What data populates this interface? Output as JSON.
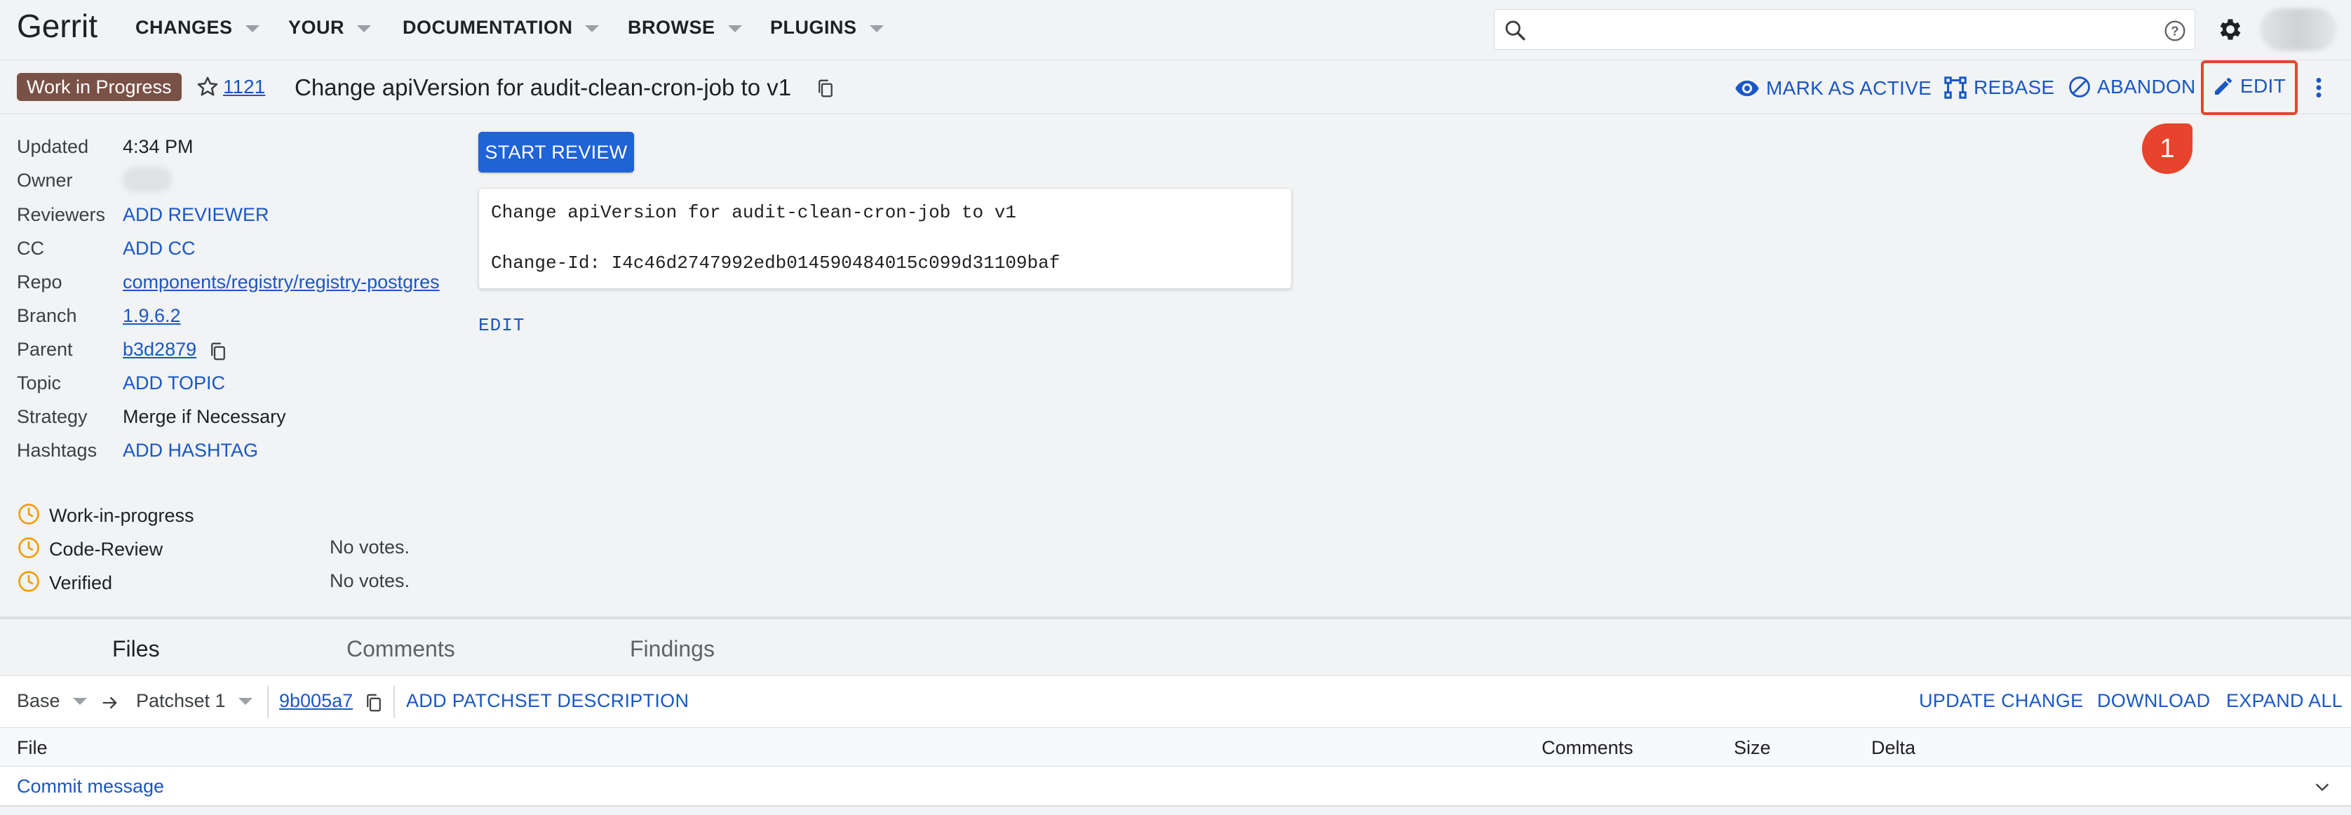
{
  "app": {
    "logo": "Gerrit"
  },
  "nav": {
    "items": [
      {
        "label": "CHANGES"
      },
      {
        "label": "YOUR"
      },
      {
        "label": "DOCUMENTATION"
      },
      {
        "label": "BROWSE"
      },
      {
        "label": "PLUGINS"
      }
    ]
  },
  "search": {
    "value": "",
    "placeholder": ""
  },
  "change": {
    "status_badge": "Work in Progress",
    "number": "1121",
    "title": "Change apiVersion for audit-clean-cron-job to v1",
    "actions": {
      "mark_active": "MARK AS ACTIVE",
      "rebase": "REBASE",
      "abandon": "ABANDON",
      "edit": "EDIT"
    }
  },
  "meta": {
    "updated_label": "Updated",
    "updated_value": "4:34 PM",
    "owner_label": "Owner",
    "reviewers_label": "Reviewers",
    "reviewers_action": "ADD REVIEWER",
    "cc_label": "CC",
    "cc_action": "ADD CC",
    "repo_label": "Repo",
    "repo_value": "components/registry/registry-postgres",
    "branch_label": "Branch",
    "branch_value": "1.9.6.2",
    "parent_label": "Parent",
    "parent_value": "b3d2879",
    "topic_label": "Topic",
    "topic_action": "ADD TOPIC",
    "strategy_label": "Strategy",
    "strategy_value": "Merge if Necessary",
    "hashtags_label": "Hashtags",
    "hashtags_action": "ADD HASHTAG"
  },
  "review": {
    "start_review": "START REVIEW",
    "commit_line1": "Change apiVersion for audit-clean-cron-job to v1",
    "commit_line2": "Change-Id: I4c46d2747992edb014590484015c099d31109baf",
    "edit": "EDIT"
  },
  "labels": [
    {
      "name": "Work-in-progress",
      "votes": ""
    },
    {
      "name": "Code-Review",
      "votes": "No votes."
    },
    {
      "name": "Verified",
      "votes": "No votes."
    }
  ],
  "tabs": [
    {
      "label": "Files"
    },
    {
      "label": "Comments"
    },
    {
      "label": "Findings"
    }
  ],
  "patchset": {
    "base": "Base",
    "patchset": "Patchset 1",
    "commit": "9b005a7",
    "add_description": "ADD PATCHSET DESCRIPTION",
    "update_change": "UPDATE CHANGE",
    "download": "DOWNLOAD",
    "expand_all": "EXPAND ALL"
  },
  "files": {
    "headers": {
      "file": "File",
      "comments": "Comments",
      "size": "Size",
      "delta": "Delta"
    },
    "rows": [
      {
        "name": "Commit message"
      }
    ]
  },
  "callout": {
    "number": "1"
  },
  "colors": {
    "accent": "#1a57c6",
    "wip_badge": "#7a5146",
    "highlight": "#e8432c",
    "label_clock": "#f29900"
  }
}
